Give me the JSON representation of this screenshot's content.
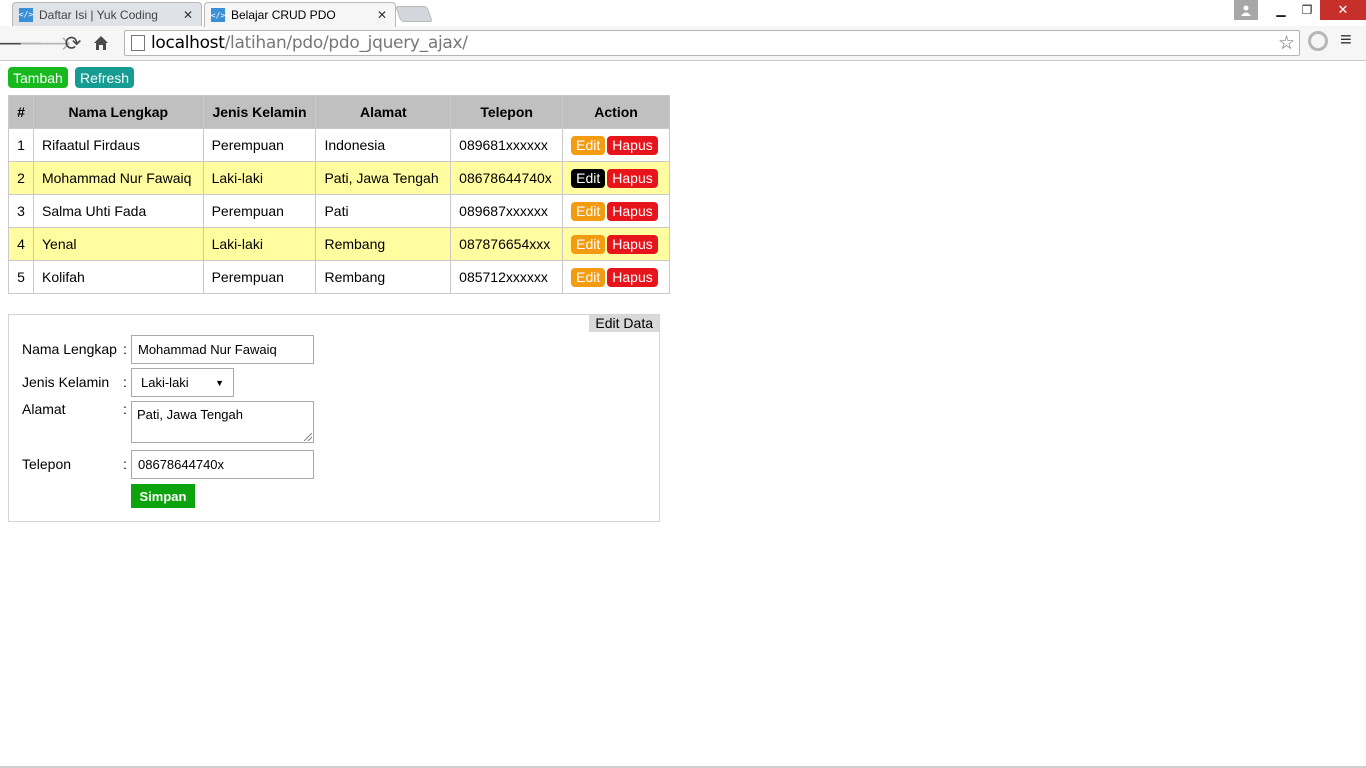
{
  "browser": {
    "tabs": [
      {
        "title": "Daftar Isi | Yuk Coding",
        "favicon": "code-icon",
        "active": false
      },
      {
        "title": "Belajar CRUD PDO",
        "favicon": "code-icon",
        "active": true
      }
    ],
    "url_host": "localhost",
    "url_path": "/latihan/pdo/pdo_jquery_ajax/"
  },
  "actions": {
    "tambah": "Tambah",
    "refresh": "Refresh"
  },
  "table": {
    "headers": [
      "#",
      "Nama Lengkap",
      "Jenis Kelamin",
      "Alamat",
      "Telepon",
      "Action"
    ],
    "rows": [
      {
        "no": "1",
        "nama": "Rifaatul Firdaus",
        "jk": "Perempuan",
        "alamat": "Indonesia",
        "telepon": "089681xxxxxx"
      },
      {
        "no": "2",
        "nama": "Mohammad Nur Fawaiq",
        "jk": "Laki-laki",
        "alamat": "Pati, Jawa Tengah",
        "telepon": "08678644740x"
      },
      {
        "no": "3",
        "nama": "Salma Uhti Fada",
        "jk": "Perempuan",
        "alamat": "Pati",
        "telepon": "089687xxxxxx"
      },
      {
        "no": "4",
        "nama": "Yenal",
        "jk": "Laki-laki",
        "alamat": "Rembang",
        "telepon": "087876654xxx"
      },
      {
        "no": "5",
        "nama": "Kolifah",
        "jk": "Perempuan",
        "alamat": "Rembang",
        "telepon": "085712xxxxxx"
      }
    ],
    "edit_label": "Edit",
    "hapus_label": "Hapus"
  },
  "form": {
    "title": "Edit Data",
    "nama_label": "Nama Lengkap",
    "nama_value": "Mohammad Nur Fawaiq",
    "jk_label": "Jenis Kelamin",
    "jk_value": "Laki-laki",
    "alamat_label": "Alamat",
    "alamat_value": "Pati, Jawa Tengah",
    "telepon_label": "Telepon",
    "telepon_value": "08678644740x",
    "colon": ":",
    "simpan": "Simpan"
  },
  "colors": {
    "tambah": "#18b81f",
    "refresh": "#179c93",
    "edit": "#f39c12",
    "hapus": "#e8141b",
    "row_highlight": "#fffda0",
    "simpan": "#0da30d"
  }
}
